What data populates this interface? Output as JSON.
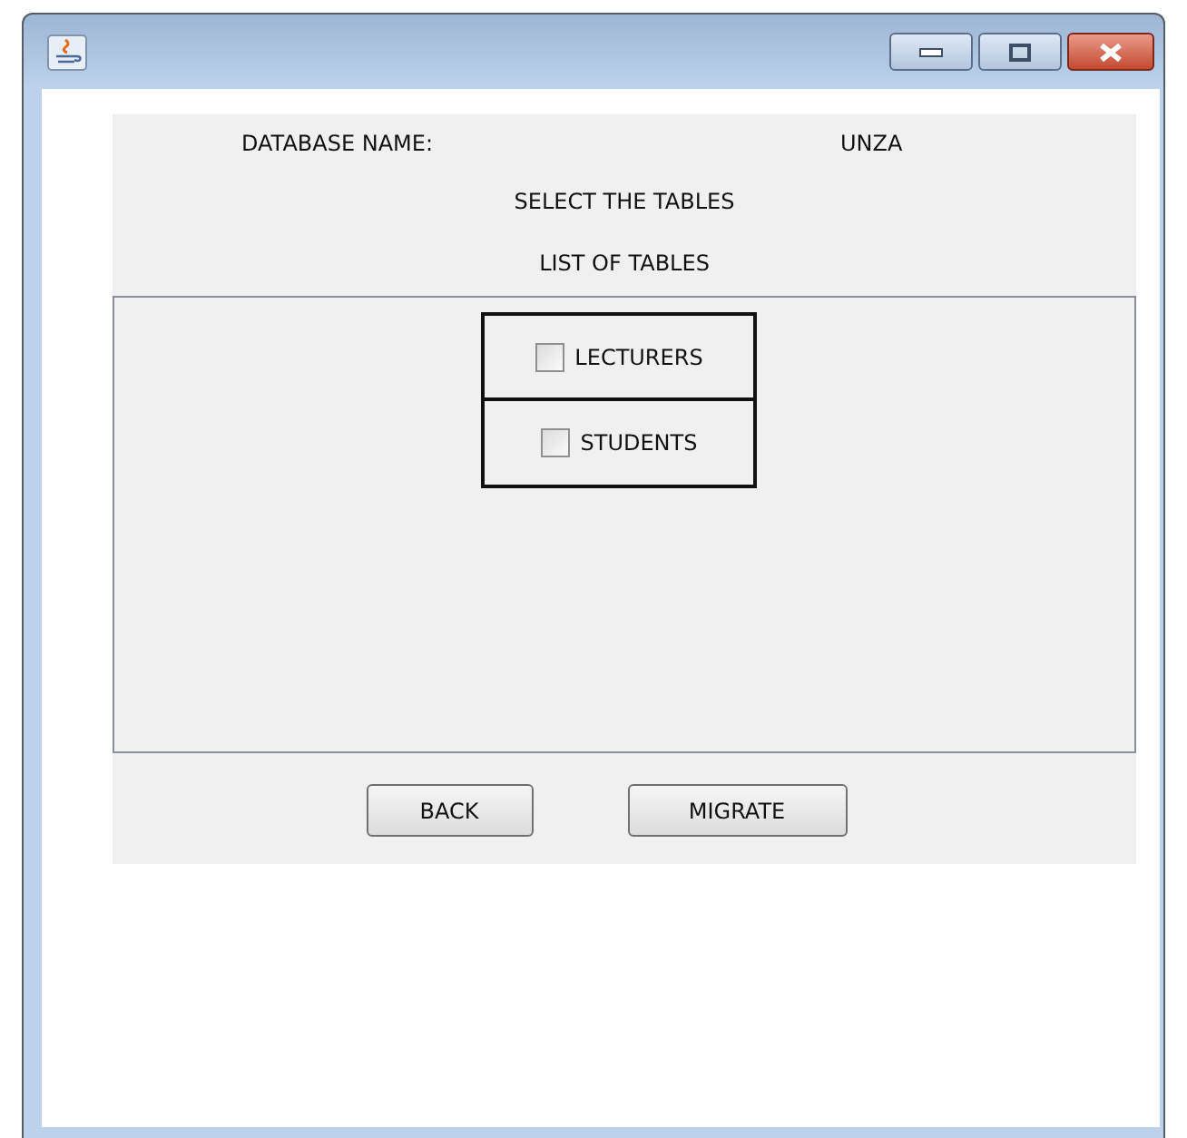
{
  "database": {
    "label": "DATABASE NAME:",
    "value": "UNZA"
  },
  "heading": "SELECT THE TABLES",
  "list_title": "LIST OF TABLES",
  "tables": [
    {
      "label": "LECTURERS",
      "checked": false
    },
    {
      "label": "STUDENTS",
      "checked": false
    }
  ],
  "buttons": [
    "BACK",
    "MIGRATE"
  ]
}
